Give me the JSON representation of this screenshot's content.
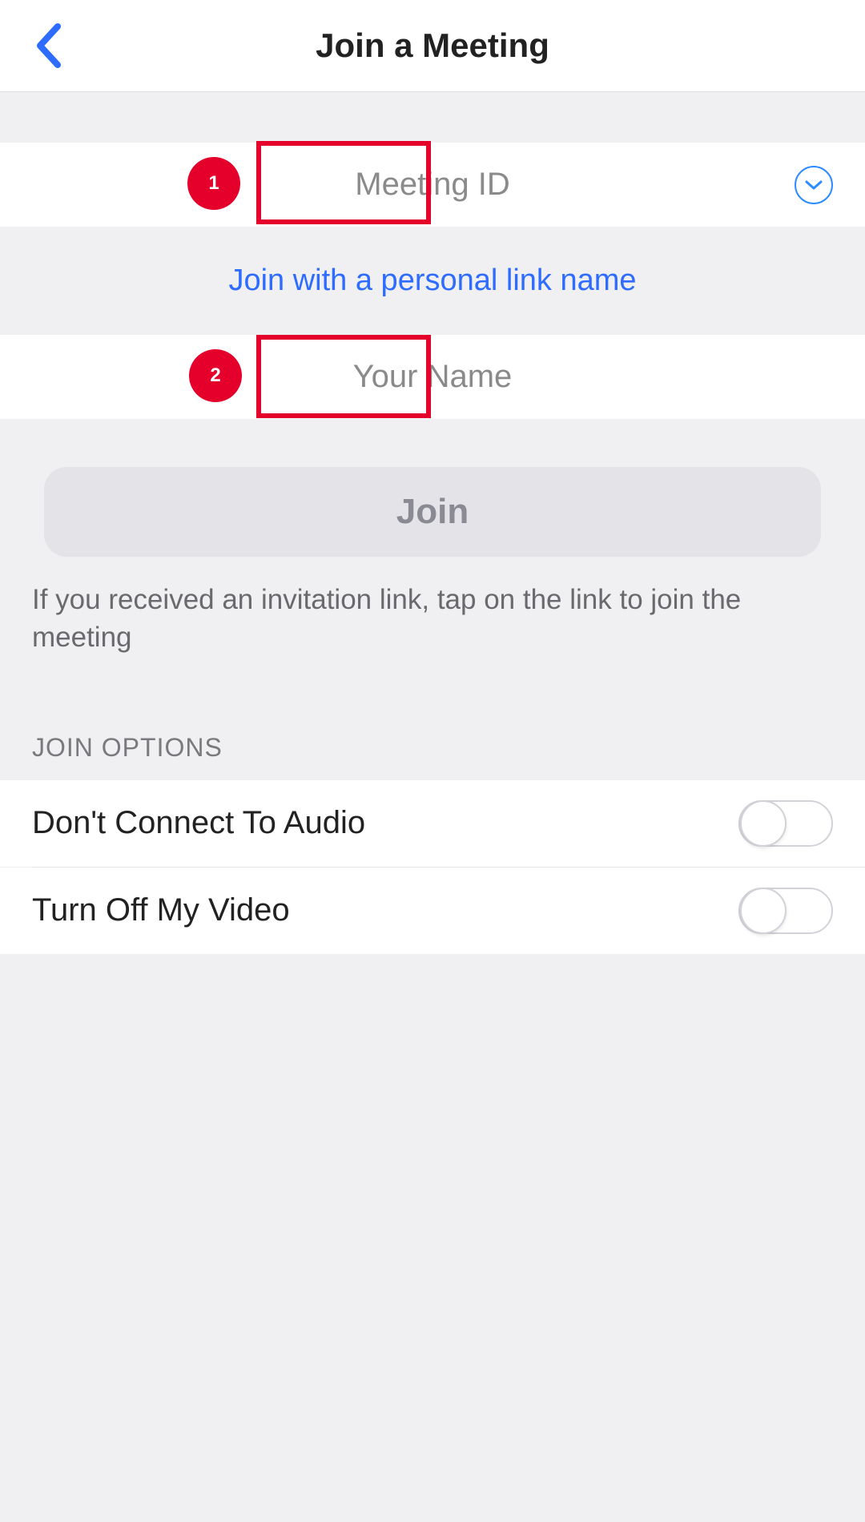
{
  "header": {
    "title": "Join a Meeting"
  },
  "meeting_id": {
    "placeholder": "Meeting ID",
    "value": ""
  },
  "personal_link": {
    "label": "Join with a personal link name"
  },
  "your_name": {
    "placeholder": "Your Name",
    "value": ""
  },
  "join_button": {
    "label": "Join"
  },
  "hint": "If you received an invitation link, tap on the link to join the meeting",
  "options": {
    "section_title": "JOIN OPTIONS",
    "items": [
      {
        "label": "Don't Connect To Audio",
        "on": false
      },
      {
        "label": "Turn Off My Video",
        "on": false
      }
    ]
  },
  "annotations": {
    "badges": [
      {
        "number": "1"
      },
      {
        "number": "2"
      }
    ]
  }
}
